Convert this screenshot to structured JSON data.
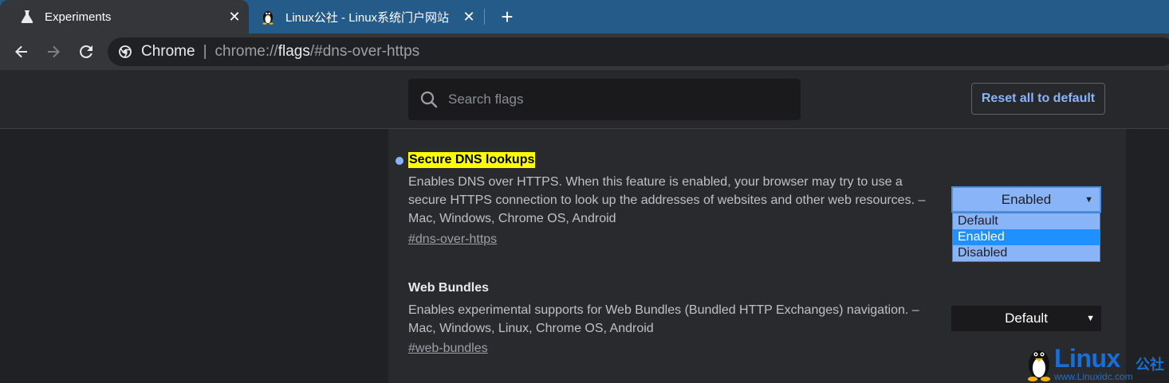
{
  "tabs": [
    {
      "title": "Experiments",
      "icon": "flask-icon",
      "active": true
    },
    {
      "title": "Linux公社 - Linux系统门户网站",
      "icon": "penguin-icon",
      "active": false
    }
  ],
  "tab_close_glyph": "✕",
  "new_tab_glyph": "+",
  "omnibox": {
    "chip": "Chrome",
    "separator": "|",
    "url_prefix": "chrome://",
    "url_host": "flags",
    "url_suffix": "/#dns-over-https"
  },
  "search": {
    "placeholder": "Search flags",
    "value": ""
  },
  "reset_label": "Reset all to default",
  "flags": [
    {
      "title": "Secure DNS lookups",
      "description": "Enables DNS over HTTPS. When this feature is enabled, your browser may try to use a secure HTTPS connection to look up the addresses of websites and other web resources. – Mac, Windows, Chrome OS, Android",
      "link": "#dns-over-https",
      "selected": "Enabled",
      "options": [
        "Default",
        "Enabled",
        "Disabled"
      ],
      "highlighted": true
    },
    {
      "title": "Web Bundles",
      "description": "Enables experimental supports for Web Bundles (Bundled HTTP Exchanges) navigation. – Mac, Windows, Linux, Chrome OS, Android",
      "link": "#web-bundles",
      "selected": "Default"
    }
  ],
  "select_arrow": "▼",
  "watermark": {
    "brand": "Linux",
    "brand_cn": "公社",
    "url": "www.Linuxidc.com"
  },
  "colors": {
    "accent": "#8ab4f8",
    "highlight": "#ffff00",
    "selected_option": "#1e90ff",
    "tabstrip": "#255b88"
  }
}
